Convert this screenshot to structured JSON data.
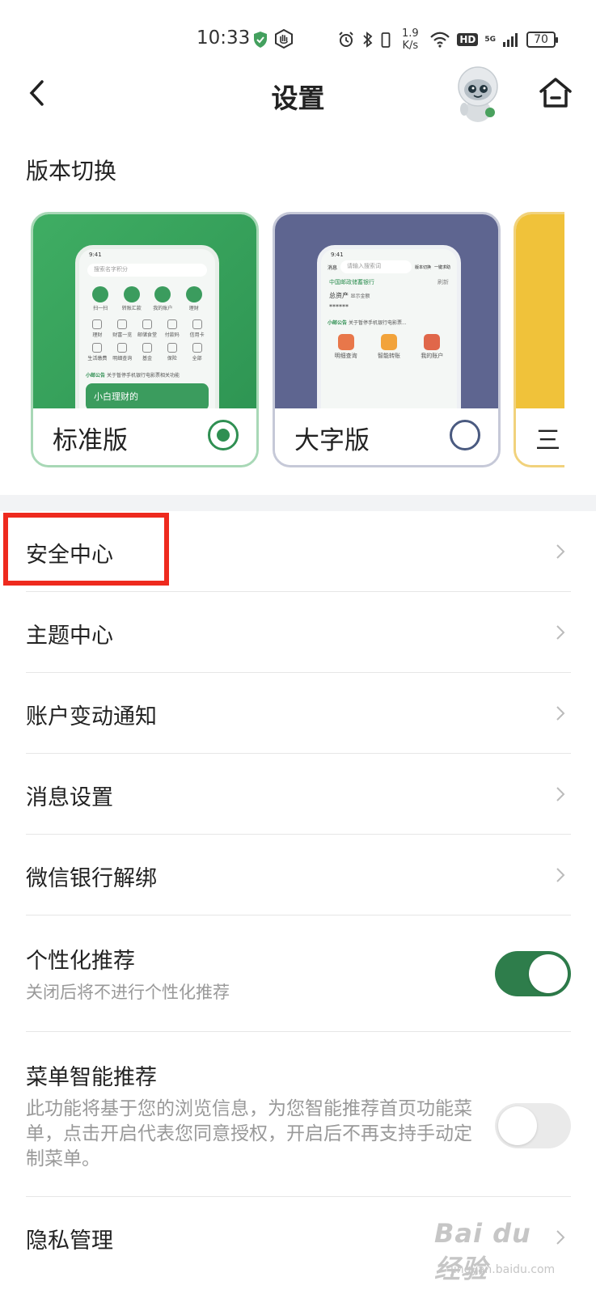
{
  "status_bar": {
    "time": "10:33",
    "net_speed_value": "1.9",
    "net_speed_unit": "K/s",
    "hd_label": "HD",
    "network_label": "5G",
    "battery": "70"
  },
  "header": {
    "title": "设置"
  },
  "version_section": {
    "label": "版本切换",
    "cards": [
      {
        "name": "标准版",
        "selected": true
      },
      {
        "name": "大字版",
        "selected": false
      },
      {
        "name": "三"
      }
    ],
    "standard_preview": {
      "time": "9:41",
      "search_placeholder": "搜索名字积分",
      "top_icons": [
        "扫一扫",
        "转账汇款",
        "我的账户",
        "理财"
      ],
      "grid": [
        "理财",
        "财富一览",
        "邮储食堂",
        "付款码",
        "信用卡",
        "生活缴费",
        "明细查询",
        "基金",
        "保险",
        "全部"
      ],
      "notice_prefix": "小邮公告",
      "notice_text": "关于暂停手机银行电影票相关功能",
      "banner": "小白理财的"
    },
    "large_preview": {
      "time": "9:41",
      "message_label": "消息",
      "search_placeholder": "请输入搜索词",
      "switch_label": "版本切换",
      "help_label": "一键求助",
      "bank_name": "中国邮政储蓄银行",
      "refresh_label": "刷新",
      "assets_label": "总资产",
      "show_amount": "显示金额",
      "masked": "******",
      "notice_prefix": "小邮公告",
      "notice_text": "关于暂停手机银行电影票...",
      "shortcuts": [
        "明细查询",
        "智能转账",
        "我的账户"
      ]
    }
  },
  "settings": [
    {
      "label": "安全中心"
    },
    {
      "label": "主题中心"
    },
    {
      "label": "账户变动通知"
    },
    {
      "label": "消息设置"
    },
    {
      "label": "微信银行解绑"
    },
    {
      "label": "个性化推荐",
      "sub": "关闭后将不进行个性化推荐",
      "toggle": true
    },
    {
      "label": "菜单智能推荐",
      "sub": "此功能将基于您的浏览信息，为您智能推荐首页功能菜单，点击开启代表您同意授权，开启后不再支持手动定制菜单。",
      "toggle": false
    },
    {
      "label": "隐私管理"
    }
  ],
  "watermark": {
    "main": "Bai du 经验",
    "sub": "jingyan.baidu.com"
  },
  "colors": {
    "brand_green": "#2f8f52",
    "toggle_on": "#2e7d4b",
    "highlight_red": "#ee2a1e",
    "large_card_bg": "#5e6590"
  }
}
